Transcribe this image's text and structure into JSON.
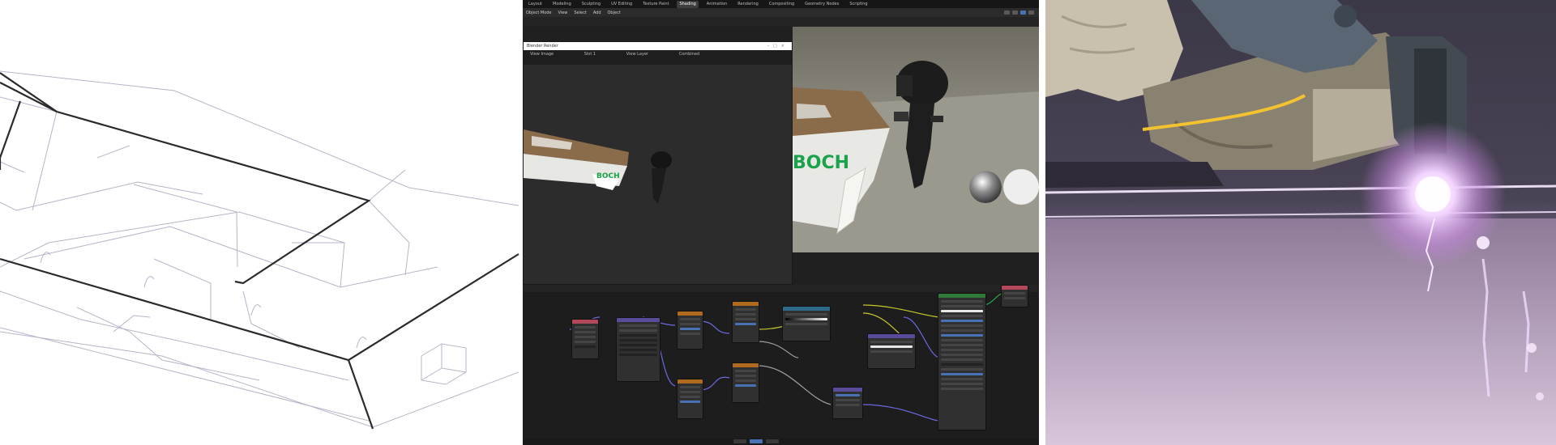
{
  "blender": {
    "workspace_tabs": [
      "Layout",
      "Modeling",
      "Sculpting",
      "UV Editing",
      "Texture Paint",
      "Shading",
      "Animation",
      "Rendering",
      "Compositing",
      "Geometry Nodes",
      "Scripting"
    ],
    "active_tab_index": 5,
    "toolbar_items": [
      "Object Mode",
      "View",
      "Select",
      "Add",
      "Object"
    ],
    "render_window": {
      "title": "Blender Render",
      "menu_items": [
        "View",
        "Image"
      ],
      "slot_label": "Slot 1",
      "layer_label": "View Layer",
      "pass_label": "Combined"
    },
    "viewport_text": "BOCH",
    "render_text": "BOCH"
  },
  "colors": {
    "accent_blue": "#4772b3",
    "node_header_red": "#b3485a",
    "node_header_purple": "#5a4a9a",
    "node_header_orange": "#b06a1e",
    "node_header_teal": "#2d6a8a",
    "node_header_green": "#2f7a3a",
    "boat_accent_green": "#1aa34a",
    "welding_glow": "#f3d6ff"
  },
  "icons": [
    "gear-icon",
    "globe-icon",
    "close-icon",
    "minimize-icon",
    "maximize-icon"
  ]
}
